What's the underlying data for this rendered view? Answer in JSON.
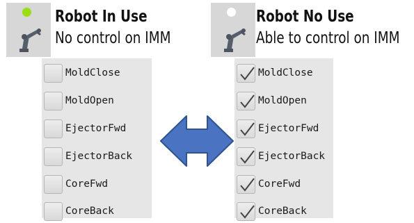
{
  "colors": {
    "in_use_dot": "#9bde12",
    "no_use_dot": "#ffffff",
    "arrow_fill": "#4a73c2",
    "arrow_stroke": "#2e5390",
    "icon_bg": "#d7d7d7",
    "panel_bg": "#e6e6e6"
  },
  "left": {
    "status_icon": "green-dot-icon",
    "robot_icon": "robot-arm-icon",
    "title": "Robot In Use",
    "subtitle": "No control on IMM",
    "checkboxes": [
      {
        "label": "MoldClose",
        "checked": false
      },
      {
        "label": "MoldOpen",
        "checked": false
      },
      {
        "label": "EjectorFwd",
        "checked": false
      },
      {
        "label": "EjectorBack",
        "checked": false
      },
      {
        "label": "CoreFwd",
        "checked": false
      },
      {
        "label": "CoreBack",
        "checked": false
      }
    ]
  },
  "right": {
    "status_icon": "white-dot-icon",
    "robot_icon": "robot-arm-icon",
    "title": "Robot No Use",
    "subtitle": "Able to control on IMM",
    "checkboxes": [
      {
        "label": "MoldClose",
        "checked": true
      },
      {
        "label": "MoldOpen",
        "checked": true
      },
      {
        "label": "EjectorFwd",
        "checked": true
      },
      {
        "label": "EjectorBack",
        "checked": true
      },
      {
        "label": "CoreFwd",
        "checked": true
      },
      {
        "label": "CoreBack",
        "checked": true
      }
    ]
  },
  "arrow_icon": "double-arrow-icon"
}
